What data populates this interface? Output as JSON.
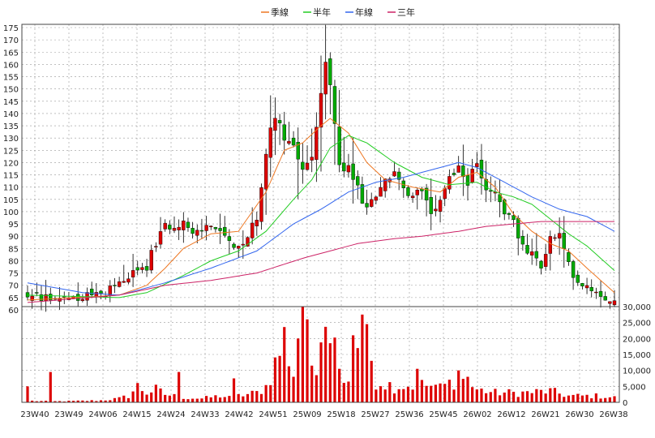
{
  "chart_data": {
    "type": "candlestick",
    "legend": {
      "placement": "top-center",
      "entries": [
        {
          "name": "季線",
          "color": "#ee7722"
        },
        {
          "name": "半年",
          "color": "#22cc22"
        },
        {
          "name": "年線",
          "color": "#3366ee"
        },
        {
          "name": "三年",
          "color": "#cc2266"
        }
      ]
    },
    "x_tick_labels": [
      "23W40",
      "23W49",
      "24W06",
      "24W15",
      "24W24",
      "24W33",
      "24W42",
      "24W51",
      "25W09",
      "25W18",
      "25W27",
      "25W36",
      "25W45",
      "26W02",
      "26W12",
      "26W21",
      "26W30",
      "26W38"
    ],
    "price_axis": {
      "min": 60,
      "max": 175,
      "step": 5,
      "position": "left"
    },
    "volume_axis": {
      "min": 0,
      "max": 30000,
      "step": 5000,
      "position": "right",
      "tick_labels": [
        "0",
        "5,000",
        "10,000",
        "15,000",
        "20,000",
        "25,000",
        "30,000"
      ]
    },
    "grid": true,
    "colors": {
      "up": "#dd0000",
      "down": "#00aa00",
      "volume": "#dd0000",
      "grid": "#999999"
    },
    "price_anchors": [
      [
        0,
        66
      ],
      [
        9,
        65
      ],
      [
        16,
        66
      ],
      [
        18,
        69
      ],
      [
        22,
        73
      ],
      [
        26,
        78
      ],
      [
        28,
        87
      ],
      [
        30,
        94
      ],
      [
        34,
        96
      ],
      [
        36,
        90
      ],
      [
        40,
        95
      ],
      [
        44,
        87
      ],
      [
        46,
        84
      ],
      [
        48,
        90
      ],
      [
        50,
        98
      ],
      [
        52,
        125
      ],
      [
        54,
        140
      ],
      [
        56,
        131
      ],
      [
        58,
        127
      ],
      [
        60,
        118
      ],
      [
        62,
        122
      ],
      [
        64,
        147
      ],
      [
        65,
        161
      ],
      [
        66,
        150
      ],
      [
        68,
        120
      ],
      [
        70,
        117
      ],
      [
        72,
        110
      ],
      [
        74,
        100
      ],
      [
        76,
        108
      ],
      [
        78,
        112
      ],
      [
        80,
        116
      ],
      [
        82,
        108
      ],
      [
        84,
        105
      ],
      [
        86,
        110
      ],
      [
        88,
        100
      ],
      [
        90,
        106
      ],
      [
        92,
        114
      ],
      [
        94,
        118
      ],
      [
        96,
        112
      ],
      [
        98,
        119
      ],
      [
        100,
        110
      ],
      [
        102,
        108
      ],
      [
        104,
        100
      ],
      [
        106,
        97
      ],
      [
        108,
        85
      ],
      [
        110,
        82
      ],
      [
        112,
        78
      ],
      [
        114,
        89
      ],
      [
        116,
        90
      ],
      [
        118,
        78
      ],
      [
        120,
        72
      ],
      [
        124,
        68
      ],
      [
        128,
        63
      ]
    ],
    "ma_quarter_anchors": [
      [
        0,
        64
      ],
      [
        20,
        66
      ],
      [
        26,
        70
      ],
      [
        30,
        77
      ],
      [
        34,
        85
      ],
      [
        40,
        91
      ],
      [
        46,
        92
      ],
      [
        52,
        108
      ],
      [
        56,
        125
      ],
      [
        60,
        128
      ],
      [
        64,
        135
      ],
      [
        66,
        138
      ],
      [
        70,
        132
      ],
      [
        74,
        120
      ],
      [
        78,
        113
      ],
      [
        84,
        110
      ],
      [
        90,
        108
      ],
      [
        94,
        114
      ],
      [
        98,
        116
      ],
      [
        102,
        110
      ],
      [
        106,
        99
      ],
      [
        110,
        92
      ],
      [
        114,
        87
      ],
      [
        118,
        84
      ],
      [
        122,
        77
      ],
      [
        128,
        67
      ]
    ],
    "ma_half_anchors": [
      [
        0,
        66
      ],
      [
        20,
        65
      ],
      [
        26,
        67
      ],
      [
        34,
        74
      ],
      [
        40,
        80
      ],
      [
        46,
        84
      ],
      [
        52,
        92
      ],
      [
        58,
        105
      ],
      [
        62,
        113
      ],
      [
        66,
        126
      ],
      [
        70,
        131
      ],
      [
        74,
        128
      ],
      [
        80,
        120
      ],
      [
        86,
        114
      ],
      [
        92,
        111
      ],
      [
        98,
        112
      ],
      [
        102,
        108
      ],
      [
        106,
        106
      ],
      [
        110,
        103
      ],
      [
        114,
        97
      ],
      [
        118,
        91
      ],
      [
        122,
        86
      ],
      [
        128,
        76
      ]
    ],
    "ma_year_anchors": [
      [
        0,
        71
      ],
      [
        12,
        67
      ],
      [
        20,
        66
      ],
      [
        30,
        71
      ],
      [
        40,
        77
      ],
      [
        50,
        84
      ],
      [
        58,
        95
      ],
      [
        64,
        101
      ],
      [
        70,
        108
      ],
      [
        76,
        112
      ],
      [
        82,
        114
      ],
      [
        90,
        118
      ],
      [
        94,
        120
      ],
      [
        98,
        118
      ],
      [
        102,
        114
      ],
      [
        106,
        110
      ],
      [
        110,
        106
      ],
      [
        116,
        101
      ],
      [
        122,
        98
      ],
      [
        128,
        92
      ]
    ],
    "ma_3year_anchors": [
      [
        0,
        63
      ],
      [
        20,
        66
      ],
      [
        30,
        70
      ],
      [
        40,
        72
      ],
      [
        50,
        75
      ],
      [
        60,
        81
      ],
      [
        66,
        84
      ],
      [
        72,
        87
      ],
      [
        80,
        89
      ],
      [
        86,
        90
      ],
      [
        94,
        92
      ],
      [
        100,
        94
      ],
      [
        106,
        95
      ],
      [
        112,
        96
      ],
      [
        118,
        96
      ],
      [
        128,
        96
      ]
    ],
    "volume_anchors": [
      [
        0,
        500
      ],
      [
        5,
        300
      ],
      [
        10,
        400
      ],
      [
        16,
        600
      ],
      [
        20,
        1200
      ],
      [
        22,
        2000
      ],
      [
        24,
        5000
      ],
      [
        26,
        3000
      ],
      [
        28,
        4000
      ],
      [
        30,
        2500
      ],
      [
        34,
        1500
      ],
      [
        38,
        1200
      ],
      [
        42,
        2000
      ],
      [
        44,
        1500
      ],
      [
        46,
        2000
      ],
      [
        50,
        3000
      ],
      [
        52,
        5000
      ],
      [
        54,
        12000
      ],
      [
        56,
        20000
      ],
      [
        58,
        9000
      ],
      [
        60,
        4500
      ],
      [
        62,
        5000
      ],
      [
        63,
        12000
      ],
      [
        64,
        21000
      ],
      [
        65,
        26000
      ],
      [
        66,
        20000
      ],
      [
        68,
        9000
      ],
      [
        70,
        4000
      ],
      [
        72,
        6000
      ],
      [
        74,
        8000
      ],
      [
        76,
        7000
      ],
      [
        80,
        5000
      ],
      [
        86,
        5500
      ],
      [
        90,
        4500
      ],
      [
        92,
        6000
      ],
      [
        94,
        8000
      ],
      [
        98,
        4000
      ],
      [
        102,
        3000
      ],
      [
        108,
        3000
      ],
      [
        114,
        3500
      ],
      [
        118,
        2000
      ],
      [
        124,
        2000
      ],
      [
        128,
        1500
      ]
    ],
    "volume_spikes": [
      [
        0,
        5000
      ],
      [
        5,
        9500
      ],
      [
        33,
        9500
      ],
      [
        45,
        7500
      ],
      [
        58,
        8000
      ],
      [
        59,
        20000
      ],
      [
        60,
        30000
      ],
      [
        61,
        26000
      ],
      [
        62,
        11500
      ],
      [
        63,
        8500
      ],
      [
        68,
        10500
      ],
      [
        70,
        6500
      ],
      [
        71,
        21000
      ],
      [
        72,
        17000
      ],
      [
        73,
        27500
      ],
      [
        74,
        24500
      ],
      [
        75,
        13000
      ],
      [
        85,
        10500
      ],
      [
        89,
        5500
      ],
      [
        94,
        10000
      ],
      [
        96,
        8000
      ]
    ]
  }
}
